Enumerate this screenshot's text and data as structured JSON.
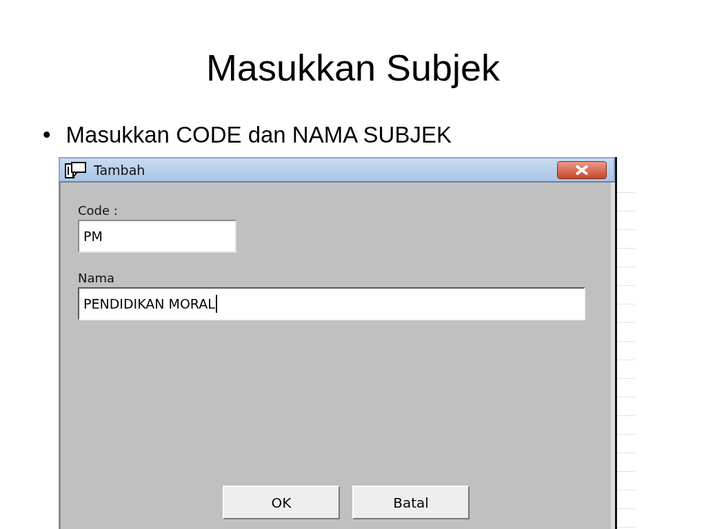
{
  "slide": {
    "title": "Masukkan Subjek",
    "bullets": [
      {
        "marker": "•",
        "text": "Masukkan CODE dan NAMA SUBJEK"
      }
    ]
  },
  "window": {
    "title": "Tambah",
    "fields": [
      {
        "label": "Code :",
        "value": "PM",
        "focused": false,
        "kind": "short"
      },
      {
        "label": "Nama",
        "value": "PENDIDIKAN MORAL",
        "focused": true,
        "kind": "long"
      }
    ],
    "buttons": [
      "OK",
      "Batal"
    ]
  }
}
